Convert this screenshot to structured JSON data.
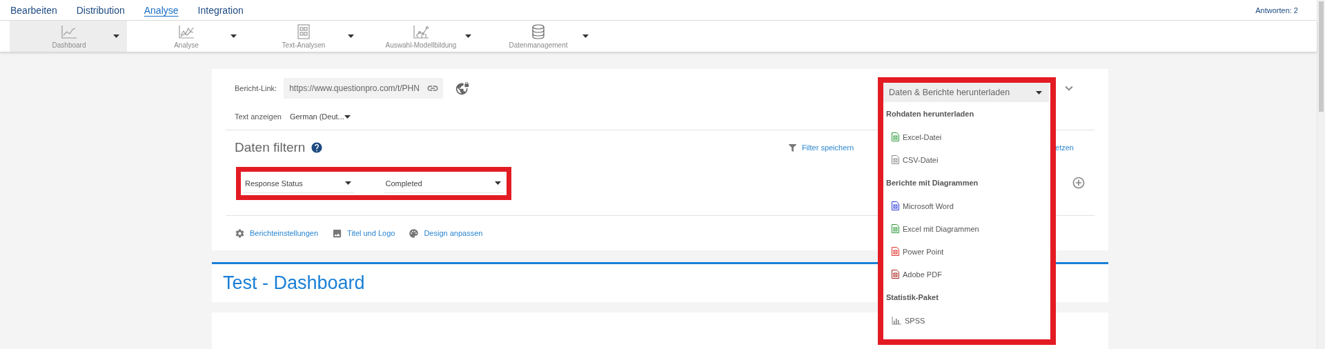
{
  "top_nav": {
    "tabs": [
      {
        "label": "Bearbeiten",
        "selected": false
      },
      {
        "label": "Distribution",
        "selected": false
      },
      {
        "label": "Analyse",
        "selected": true
      },
      {
        "label": "Integration",
        "selected": false
      }
    ],
    "responses": "Antworten: 2"
  },
  "toolbar": [
    {
      "label": "Dashboard",
      "kind": "line-chart",
      "selected": true
    },
    {
      "label": "Analyse",
      "kind": "trend-chart",
      "selected": false
    },
    {
      "label": "Text-Analysen",
      "kind": "text-doc",
      "selected": false
    },
    {
      "label": "Auswahl-Modellbildung",
      "kind": "scatter-chart",
      "selected": false
    },
    {
      "label": "Datenmanagement",
      "kind": "database",
      "selected": false
    }
  ],
  "report_link": {
    "label": "Bericht-Link:",
    "value": "https://www.questionpro.com/t/PHN"
  },
  "language": {
    "label": "Text anzeigen",
    "value": "German (Deut..."
  },
  "filter": {
    "title": "Daten filtern",
    "save": "Filter speichern",
    "reset": "etzen",
    "conditions": [
      {
        "field": "Response Status",
        "value": "Completed"
      }
    ]
  },
  "actions": [
    {
      "label": "Berichteinstellungen",
      "kind": "gear"
    },
    {
      "label": "Titel und Logo",
      "kind": "image"
    },
    {
      "label": "Design anpassen",
      "kind": "palette"
    }
  ],
  "dashboard_title": "Test - Dashboard",
  "download_menu": {
    "button": "Daten & Berichte herunterladen",
    "expanded": true,
    "groups": [
      {
        "title": "Rohdaten herunterladen",
        "items": [
          {
            "label": "Excel-Datei",
            "kind": "excel"
          },
          {
            "label": "CSV-Datei",
            "kind": "csv"
          }
        ]
      },
      {
        "title": "Berichte mit Diagrammen",
        "items": [
          {
            "label": "Microsoft Word",
            "kind": "word"
          },
          {
            "label": "Excel mit Diagrammen",
            "kind": "excel"
          },
          {
            "label": "Power Point",
            "kind": "powerpoint"
          },
          {
            "label": "Adobe PDF",
            "kind": "pdf"
          }
        ]
      },
      {
        "title": "Statistik-Paket",
        "items": [
          {
            "label": "SPSS",
            "kind": "spss"
          }
        ]
      }
    ]
  }
}
